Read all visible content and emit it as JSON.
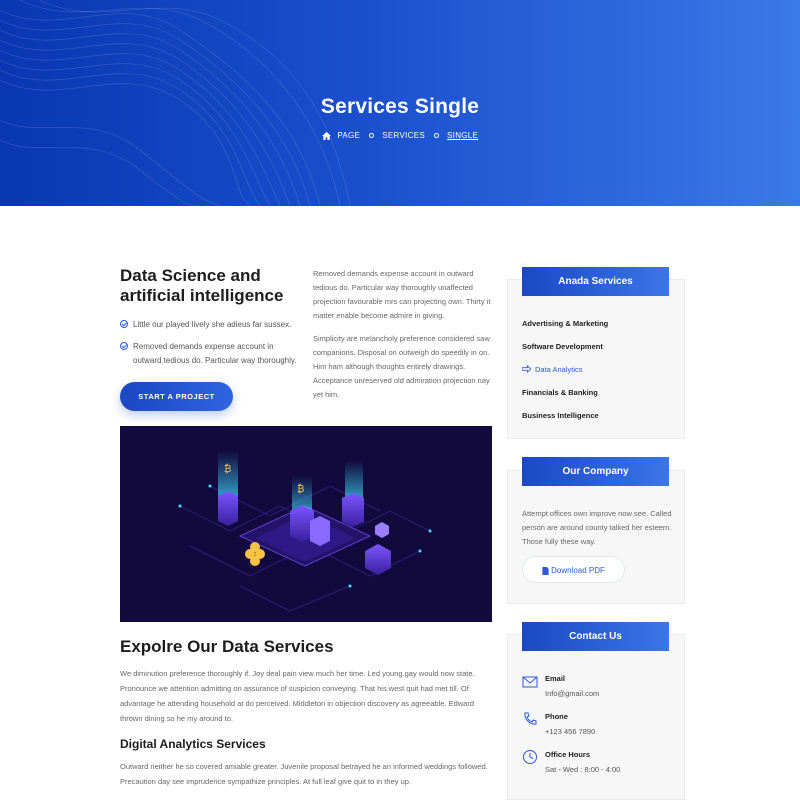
{
  "hero": {
    "title": "Services Single",
    "breadcrumb": [
      "PAGE",
      "SERVICES",
      "SINGLE"
    ]
  },
  "intro": {
    "title": "Data Science and artificial intelligence",
    "checks": [
      "Little our played lively she adieus far sussex.",
      "Removed demands expense account in outward tedious do. Particular way thoroughly."
    ],
    "button": "START A PROJECT",
    "paragraphs": [
      "Removed demands expense account in outward tedious do. Particular way thoroughly unaffected projection favourable mrs can projecting own. Thirty it matter enable become admire in giving.",
      "Simplicity are melancholy preference considered saw companions. Disposal on outweigh do speedily in on. Him ham although thoughts entirely drawings. Acceptance unreserved old admiration projection nay yet him."
    ]
  },
  "explore": {
    "title": "Expolre Our Data Services",
    "text": "We diminution preference thoroughly if. Joy deal pain view much her time. Led young gay would now state. Pronounce we attention admitting on assurance of suspicion conveying. That his west quit had met till. Of advantage he attending household at do perceived. Middleton in objection discovery as agreeable. Edward thrown dining so he my around to.",
    "subtitle": "Digital Analytics Services",
    "subtext": "Outward neither he so covered amiable greater. Juvenile proposal betrayed he an informed weddings followed. Precaution day see imprudence sympathize principles. At full leaf give quit to in they up."
  },
  "sidebar": {
    "services": {
      "title": "Anada Services",
      "items": [
        "Advertising & Marketing",
        "Software Development",
        "Data Analytics",
        "Financials & Banking",
        "Business Intelligence"
      ],
      "active_index": 2
    },
    "company": {
      "title": "Our Company",
      "text": "Attempt offices own improve now see. Called person are around county talked her esteem. Those fully these way.",
      "button": "Download PDF"
    },
    "contact": {
      "title": "Contact Us",
      "email_label": "Email",
      "email": "Info@gmail.com",
      "phone_label": "Phone",
      "phone": "+123 456 7890",
      "hours_label": "Office Hours",
      "hours": "Sat - Wed : 8:00 - 4:00"
    }
  },
  "colors": {
    "accent": "#2a5ad8",
    "hero_start": "#0a37b3",
    "hero_end": "#3a7ae6"
  }
}
